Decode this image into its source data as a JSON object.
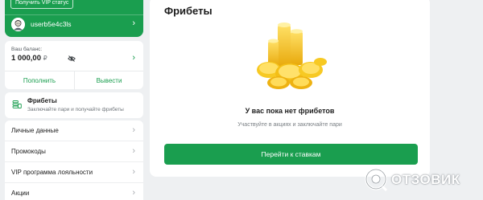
{
  "user": {
    "vip_label": "Получить VIP статус",
    "username": "userb5e4c3ls"
  },
  "balance": {
    "label": "Ваш баланс:",
    "amount": "1 000,00",
    "currency": "₽",
    "deposit_label": "Пополнить",
    "withdraw_label": "Вывести"
  },
  "freebets_item": {
    "title": "Фрибеты",
    "subtitle": "Заключайте пари и получайте фрибеты"
  },
  "menu": {
    "items": [
      {
        "label": "Личные данные"
      },
      {
        "label": "Промокоды"
      },
      {
        "label": "VIP программа лояльности"
      },
      {
        "label": "Акции"
      }
    ]
  },
  "main": {
    "title": "Фрибеты",
    "empty_title": "У вас пока нет фрибетов",
    "empty_subtitle": "Участвуйте в акциях и заключайте пари",
    "cta_label": "Перейти к ставкам"
  },
  "watermark": {
    "text": "ОТЗОВИК"
  },
  "icons": {
    "chevron": "›"
  },
  "colors": {
    "brand_green": "#1a9e4f",
    "background": "#eef0f2",
    "coin_gold": "#f5c518"
  }
}
